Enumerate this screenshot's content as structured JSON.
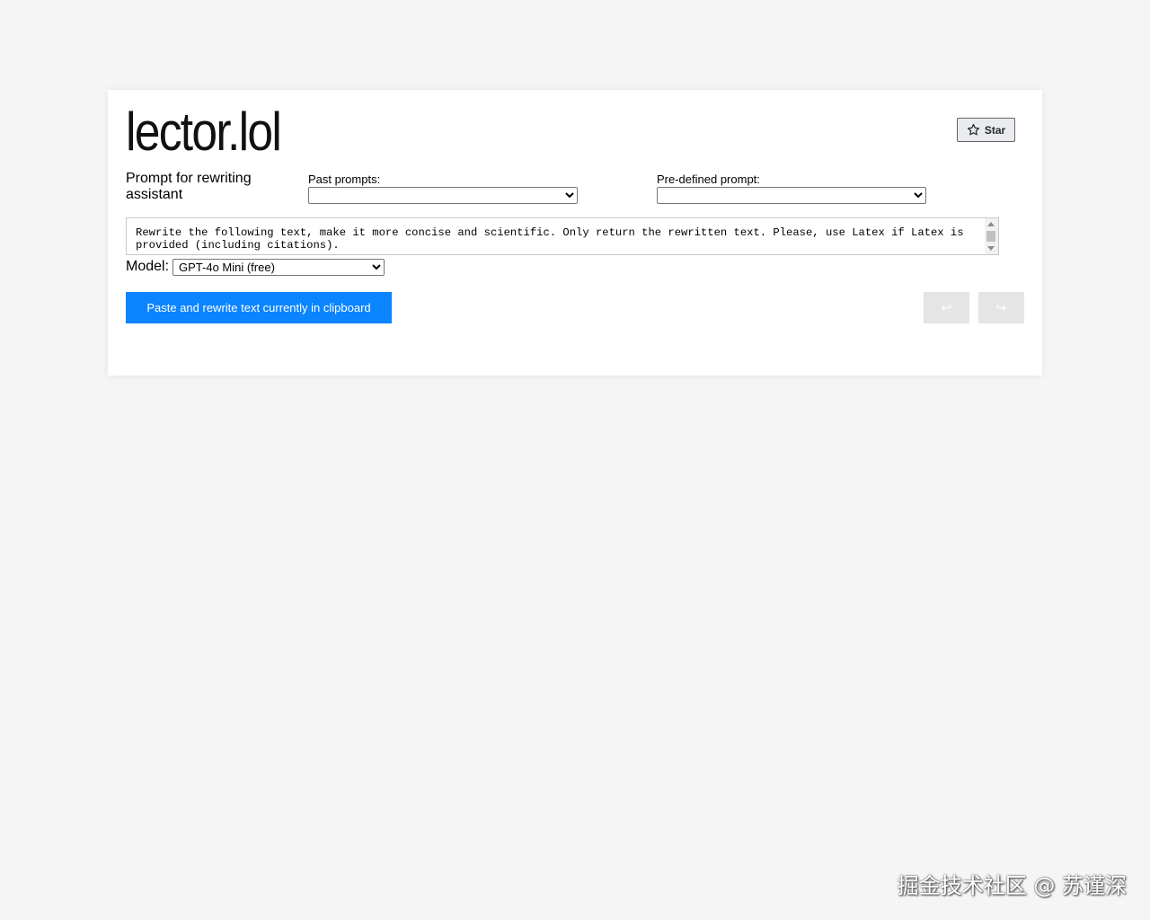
{
  "app": {
    "logo_text": "lector.lol"
  },
  "header": {
    "star_label": "Star"
  },
  "prompt": {
    "title": "Prompt for rewriting assistant",
    "past_prompts_label": "Past prompts:",
    "past_prompts_value": "",
    "predefined_label": "Pre-defined prompt:",
    "predefined_value": "",
    "text": "Rewrite the following text, make it more concise and scientific. Only return the rewritten text. Please, use Latex if Latex is provided (including citations)."
  },
  "model": {
    "label": "Model:",
    "selected": "GPT-4o Mini (free)"
  },
  "actions": {
    "paste_rewrite_label": "Paste and rewrite text currently in clipboard",
    "undo_symbol": "↩",
    "redo_symbol": "↪"
  },
  "watermark": {
    "text": "掘金技术社区 @ 苏谨深"
  },
  "colors": {
    "primary": "#0a84ff",
    "background": "#f5f5f5",
    "card": "#ffffff",
    "nav_button_disabled": "#e5e5e5"
  },
  "icons": {
    "star": "star-outline-icon"
  }
}
